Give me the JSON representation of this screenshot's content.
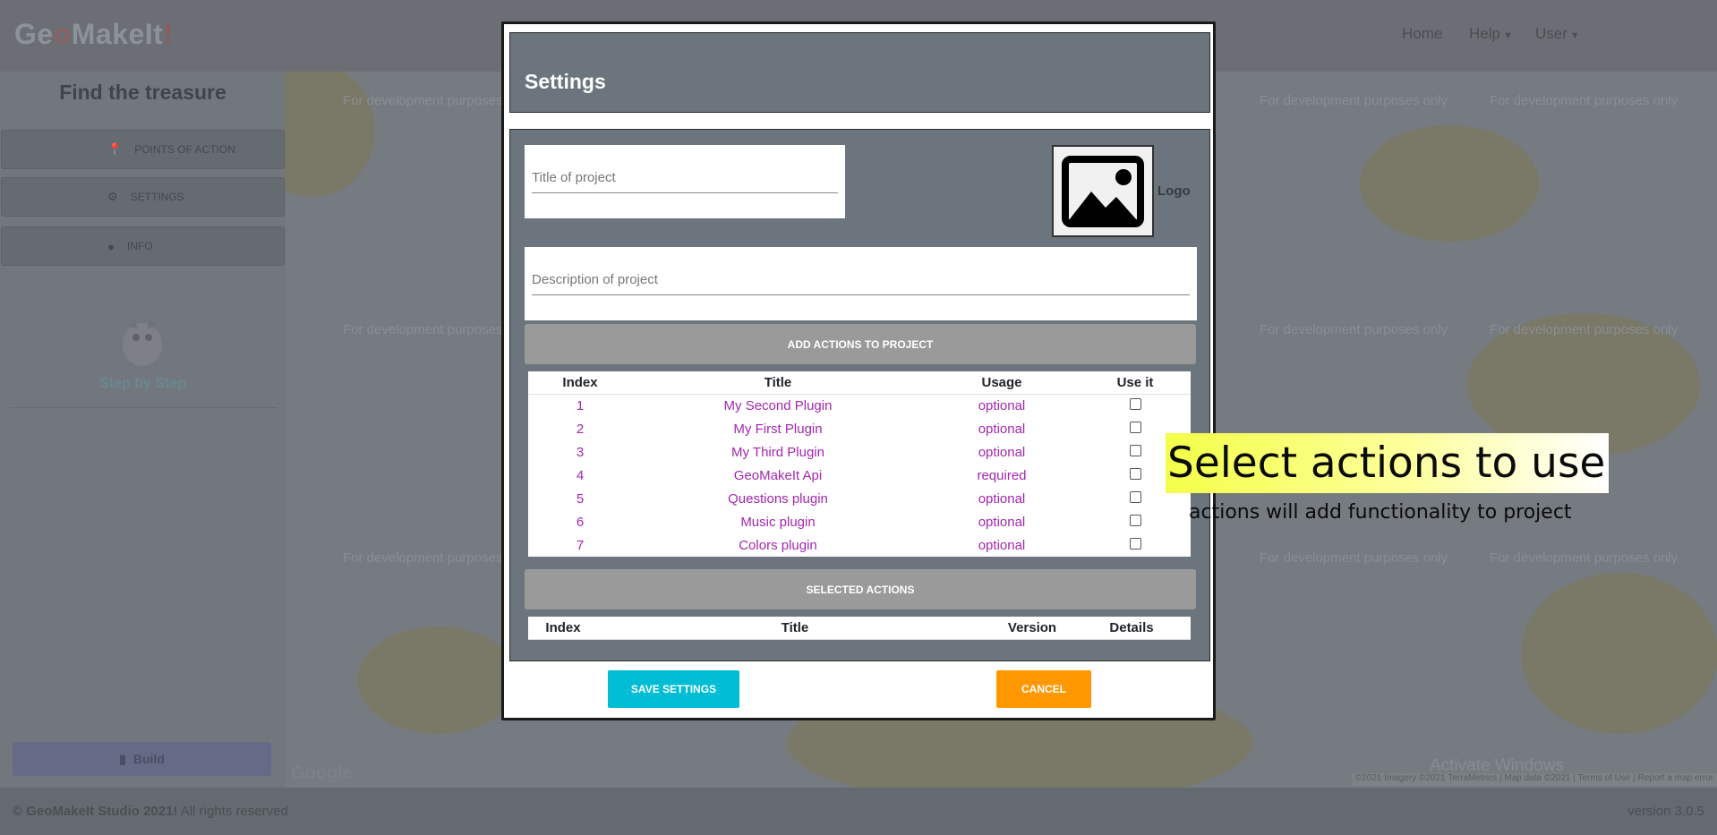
{
  "app": {
    "brand": {
      "part1": "Ge",
      "part2": "o",
      "part3": "MakeIt",
      "part4": "!"
    },
    "nav": {
      "home": "Home",
      "help": "Help",
      "user": "User"
    }
  },
  "sidebar": {
    "title": "Find the treasure",
    "items": [
      {
        "label": "POINTS OF ACTION",
        "icon": "map-pin-icon"
      },
      {
        "label": "SETTINGS",
        "icon": "gear-icon"
      },
      {
        "label": "INFO",
        "icon": "info-icon"
      }
    ],
    "step": "Step by Step",
    "build": "Build"
  },
  "map": {
    "watermark": "For development purposes only",
    "activate": "Activate Windows",
    "attribution": "©2021 Imagery ©2021 TerraMetrics | Map data ©2021 | Terms of Use | Report a map error"
  },
  "footer": {
    "copyright_bold": "© GeoMakeIt Studio 2021!",
    "copyright_rest": " All rights reserved",
    "version": "version 3.0.5"
  },
  "modal": {
    "title": "Settings",
    "title_placeholder": "Title of project",
    "description_placeholder": "Description of project",
    "logo_label": "Logo",
    "add_actions_label": "ADD ACTIONS TO PROJECT",
    "actions_table": {
      "headers": [
        "Index",
        "Title",
        "Usage",
        "Use it"
      ],
      "rows": [
        {
          "index": "1",
          "title": "My Second Plugin",
          "usage": "optional"
        },
        {
          "index": "2",
          "title": "My First Plugin",
          "usage": "optional"
        },
        {
          "index": "3",
          "title": "My Third Plugin",
          "usage": "optional"
        },
        {
          "index": "4",
          "title": "GeoMakeIt Api",
          "usage": "required"
        },
        {
          "index": "5",
          "title": "Questions plugin",
          "usage": "optional"
        },
        {
          "index": "6",
          "title": "Music plugin",
          "usage": "optional"
        },
        {
          "index": "7",
          "title": "Colors plugin",
          "usage": "optional"
        }
      ]
    },
    "selected_actions_label": "SELECTED ACTIONS",
    "selected_table": {
      "headers": [
        "Index",
        "Title",
        "Version",
        "Details"
      ]
    },
    "save_label": "SAVE SETTINGS",
    "cancel_label": "CANCEL"
  },
  "tutorial": {
    "heading": "Select actions to use",
    "subtext": "actions will add functionality to project"
  },
  "colors": {
    "accent_save": "#00bcd4",
    "accent_cancel": "#ff9800",
    "link_purple": "#a327b0",
    "modal_panel": "#6c757d"
  }
}
